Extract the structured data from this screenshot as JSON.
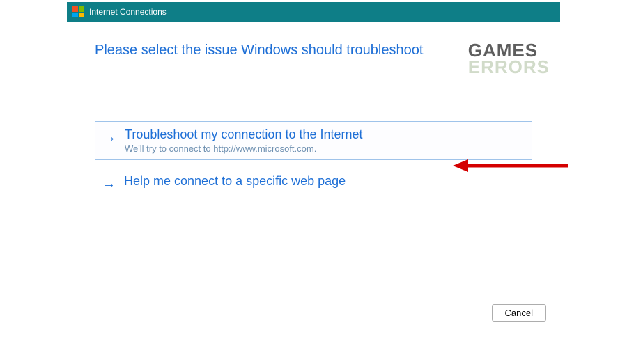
{
  "titlebar": {
    "title": "Internet Connections"
  },
  "heading": "Please select the issue Windows should troubleshoot",
  "watermark": {
    "line1": "GAMES",
    "line2": "ERRORS"
  },
  "options": [
    {
      "title": "Troubleshoot my connection to the Internet",
      "description": "We'll try to connect to http://www.microsoft.com.",
      "selected": true
    },
    {
      "title": "Help me connect to a specific web page",
      "description": "",
      "selected": false
    }
  ],
  "footer": {
    "cancel_label": "Cancel"
  },
  "colors": {
    "accent": "#1e6fd6",
    "titlebar_bg": "#0e7e87",
    "annotation_red": "#d40000"
  }
}
